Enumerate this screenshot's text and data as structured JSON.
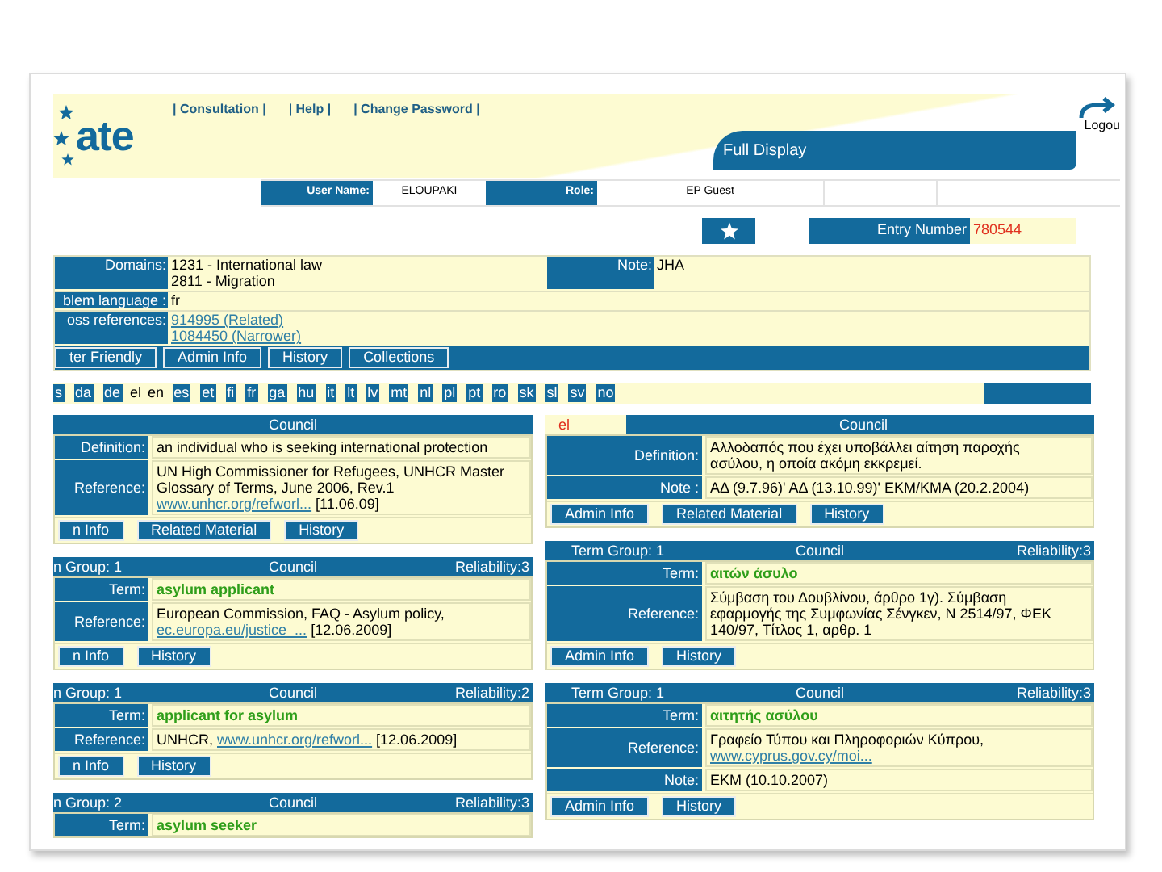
{
  "header": {
    "logo": "ate",
    "nav": [
      "| Consultation |",
      "| Help |",
      "| Change Password |"
    ],
    "logout": "Logou",
    "title": "Full Display"
  },
  "user_bar": [
    {
      "label": "User Name:",
      "value": "ELOUPAKI"
    },
    {
      "label": "Role:",
      "value": "EP Guest"
    }
  ],
  "entry_number": {
    "label": "Entry Number",
    "value": "780544"
  },
  "entry": {
    "domains": {
      "label": "Domains:",
      "lines": [
        "1231 - International law",
        "2811 - Migration"
      ]
    },
    "note": {
      "label": "Note:",
      "value": "JHA"
    },
    "language": {
      "label": "blem language :",
      "value": "fr"
    },
    "references": {
      "label": "oss references:",
      "links": [
        "914995 (Related)",
        "1084450 (Narrower)"
      ]
    },
    "buttons": [
      "ter Friendly",
      "Admin Info",
      "History",
      "Collections"
    ]
  },
  "languages": [
    {
      "code": "s",
      "selected": false
    },
    {
      "code": "da",
      "selected": false
    },
    {
      "code": "de",
      "selected": false
    },
    {
      "code": "el",
      "selected": true
    },
    {
      "code": "en",
      "selected": true
    },
    {
      "code": "es",
      "selected": false
    },
    {
      "code": "et",
      "selected": false
    },
    {
      "code": "fi",
      "selected": false
    },
    {
      "code": "fr",
      "selected": false
    },
    {
      "code": "ga",
      "selected": false
    },
    {
      "code": "hu",
      "selected": false
    },
    {
      "code": "it",
      "selected": false
    },
    {
      "code": "lt",
      "selected": false
    },
    {
      "code": "lv",
      "selected": false
    },
    {
      "code": "mt",
      "selected": false
    },
    {
      "code": "nl",
      "selected": false
    },
    {
      "code": "pl",
      "selected": false
    },
    {
      "code": "pt",
      "selected": false
    },
    {
      "code": "ro",
      "selected": false
    },
    {
      "code": "sk",
      "selected": false
    },
    {
      "code": "sl",
      "selected": false
    },
    {
      "code": "sv",
      "selected": false
    },
    {
      "code": "no",
      "selected": false
    }
  ],
  "columns": [
    {
      "blocks": [
        {
          "header": {
            "source": "Council"
          },
          "rows": [
            {
              "label": "Definition:",
              "lines": [
                [
                  {
                    "kind": "text",
                    "text": "an individual who is seeking international protection"
                  }
                ]
              ]
            },
            {
              "label": "Reference:",
              "lines": [
                [
                  {
                    "kind": "text",
                    "text": "UN High Commissioner for Refugees, UNHCR Master"
                  }
                ],
                [
                  {
                    "kind": "text",
                    "text": "Glossary of Terms, June 2006, Rev.1"
                  }
                ],
                [
                  {
                    "kind": "link",
                    "text": "www.unhcr.org/refworl..."
                  },
                  {
                    "kind": "text",
                    "text": " [11.06.09]"
                  }
                ]
              ]
            }
          ],
          "buttons": [
            "n Info",
            "Related Material",
            "History"
          ]
        },
        {
          "header": {
            "group": "n Group: 1",
            "source": "Council",
            "reliability": "Reliability:3"
          },
          "rows": [
            {
              "label": "Term:",
              "lines": [
                [
                  {
                    "kind": "term",
                    "text": "asylum applicant"
                  }
                ]
              ]
            },
            {
              "label": "Reference:",
              "lines": [
                [
                  {
                    "kind": "text",
                    "text": "European Commission, FAQ - Asylum policy,"
                  }
                ],
                [
                  {
                    "kind": "link",
                    "text": "ec.europa.eu/justice_..."
                  },
                  {
                    "kind": "text",
                    "text": " [12.06.2009]"
                  }
                ]
              ]
            }
          ],
          "buttons": [
            "n Info",
            "History"
          ]
        },
        {
          "header": {
            "group": "n Group: 1",
            "source": "Council",
            "reliability": "Reliability:2"
          },
          "rows": [
            {
              "label": "Term:",
              "lines": [
                [
                  {
                    "kind": "term",
                    "text": "applicant for asylum"
                  }
                ]
              ]
            },
            {
              "label": "Reference:",
              "lines": [
                [
                  {
                    "kind": "text",
                    "text": "UNHCR, "
                  },
                  {
                    "kind": "link",
                    "text": "www.unhcr.org/refworl..."
                  },
                  {
                    "kind": "text",
                    "text": " [12.06.2009]"
                  }
                ]
              ]
            }
          ],
          "buttons": [
            "n Info",
            "History"
          ]
        },
        {
          "header": {
            "group": "n Group: 2",
            "source": "Council",
            "reliability": "Reliability:3"
          },
          "rows": [
            {
              "label": "Term:",
              "lines": [
                [
                  {
                    "kind": "term",
                    "text": "asylum seeker"
                  }
                ]
              ]
            }
          ]
        }
      ]
    },
    {
      "blocks": [
        {
          "header": {
            "lang": "el",
            "source": "Council"
          },
          "rows": [
            {
              "label": "Definition:",
              "lines": [
                [
                  {
                    "kind": "text",
                    "text": "Αλλοδαπός που έχει υποβάλλει αίτηση παροχής"
                  }
                ],
                [
                  {
                    "kind": "text",
                    "text": "ασύλου, η οποία ακόμη εκκρεμεί."
                  }
                ]
              ]
            },
            {
              "label": "Note :",
              "lines": [
                [
                  {
                    "kind": "text",
                    "text": "ΑΔ (9.7.96)' ΑΔ (13.10.99)' ΕΚΜ/ΚΜΑ (20.2.2004)"
                  }
                ]
              ]
            }
          ],
          "buttons": [
            "Admin Info",
            "Related Material",
            "History"
          ]
        },
        {
          "header": {
            "group": "Term Group: 1",
            "source": "Council",
            "reliability": "Reliability:3"
          },
          "rows": [
            {
              "label": "Term:",
              "lines": [
                [
                  {
                    "kind": "term",
                    "text": "αιτών άσυλο"
                  }
                ]
              ]
            },
            {
              "label": "Reference:",
              "lines": [
                [
                  {
                    "kind": "text",
                    "text": "Σύμβαση του Δουβλίνου, άρθρο 1γ). Σύμβαση"
                  }
                ],
                [
                  {
                    "kind": "text",
                    "text": "εφαρμογής της Συμφωνίας Σένγκεν, Ν 2514/97, ΦΕΚ"
                  }
                ],
                [
                  {
                    "kind": "text",
                    "text": "140/97, Τίτλος 1, αρθρ. 1"
                  }
                ]
              ]
            }
          ],
          "buttons": [
            "Admin Info",
            "History"
          ]
        },
        {
          "header": {
            "group": "Term Group: 1",
            "source": "Council",
            "reliability": "Reliability:3"
          },
          "rows": [
            {
              "label": "Term:",
              "lines": [
                [
                  {
                    "kind": "term",
                    "text": "αιτητής ασύλου"
                  }
                ]
              ]
            },
            {
              "label": "Reference:",
              "lines": [
                [
                  {
                    "kind": "text",
                    "text": "Γραφείο Τύπου και Πληροφοριών Κύπρου,"
                  }
                ],
                [
                  {
                    "kind": "link",
                    "text": "www.cyprus.gov.cy/moi..."
                  }
                ]
              ]
            },
            {
              "label": "Note:",
              "lines": [
                [
                  {
                    "kind": "text",
                    "text": "ΕΚΜ (10.10.2007)"
                  }
                ]
              ]
            }
          ],
          "buttons": [
            "Admin Info",
            "History"
          ]
        }
      ]
    }
  ]
}
